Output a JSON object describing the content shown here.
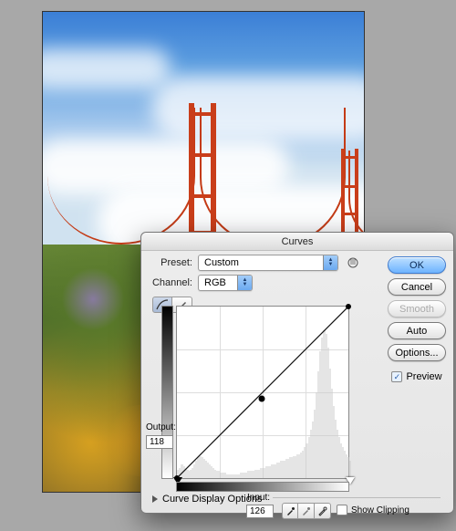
{
  "dialog": {
    "title": "Curves",
    "preset_label": "Preset:",
    "preset_value": "Custom",
    "channel_label": "Channel:",
    "channel_value": "RGB",
    "output_label": "Output:",
    "output_value": "118",
    "input_label": "Input:",
    "input_value": "126",
    "show_clipping_label": "Show Clipping",
    "disclosure_label": "Curve Display Options"
  },
  "buttons": {
    "ok": "OK",
    "cancel": "Cancel",
    "smooth": "Smooth",
    "auto": "Auto",
    "options": "Options...",
    "preview_label": "Preview"
  },
  "state": {
    "show_clipping_checked": false,
    "preview_checked": true,
    "smooth_enabled": false
  },
  "curve": {
    "point": {
      "input": 126,
      "output": 118
    },
    "range": 255
  }
}
